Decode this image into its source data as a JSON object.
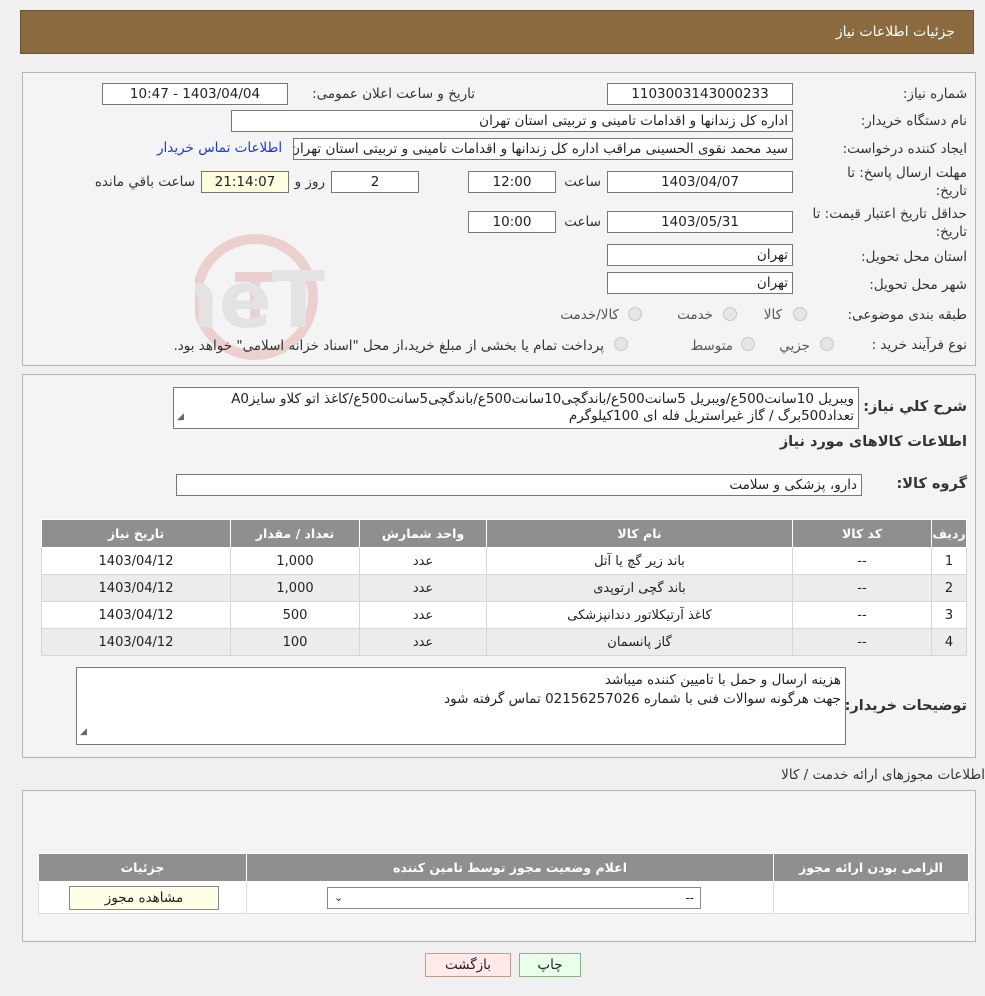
{
  "header": {
    "title": "جزئیات اطلاعات نیاز"
  },
  "fields": {
    "need_number_label": "شماره نیاز:",
    "need_number": "1103003143000233",
    "announce_label": "تاریخ و ساعت اعلان عمومی:",
    "announce_value": "1403/04/04 - 10:47",
    "buyer_label": "نام دستگاه خریدار:",
    "buyer_value": "اداره کل زندانها و اقدامات تامینی و تربیتی استان تهران",
    "creator_label": "ایجاد کننده درخواست:",
    "creator_value": "سید محمد نقوی الحسینی مراقب  اداره کل زندانها و اقدامات تامینی و تربیتی استان تهران",
    "contact_link": "اطلاعات تماس خریدار",
    "deadline_label": "مهلت ارسال پاسخ: تا تاریخ:",
    "deadline_date": "1403/04/07",
    "hour_label": "ساعت",
    "deadline_time": "12:00",
    "days_value": "2",
    "days_label": "روز و",
    "remaining_value": "21:14:07",
    "remaining_label": "ساعت باقي مانده",
    "validity_label": "حداقل تاریخ اعتبار قیمت: تا تاریخ:",
    "validity_date": "1403/05/31",
    "validity_hour_label": "ساعت",
    "validity_time": "10:00",
    "province_label": "استان محل تحویل:",
    "province_value": "تهران",
    "city_label": "شهر محل تحویل:",
    "city_value": "تهران",
    "category_label": "طبقه بندی موضوعی:",
    "category_options": [
      "کالا",
      "خدمت",
      "کالا/خدمت"
    ],
    "process_label": "نوع فرآیند خرید :",
    "process_options": [
      "جزيي",
      "متوسط"
    ],
    "process_note": "پرداخت تمام یا بخشی از مبلغ خرید،از محل \"اسناد خزانه اسلامی\" خواهد بود."
  },
  "summary": {
    "label": "شرح کلي نياز:",
    "text": "ویبریل 10سانت500ع/ویبریل 5سانت500ع/باندگچی10سانت500ع/باندگچی5سانت500ع/کاغذ اتو کلاو سایزA0 تعداد500برگ / گاز غیراستریل فله ای 100کیلوگرم",
    "goods_info_label": "اطلاعات کالاهای مورد نیاز",
    "group_label": "گروه کالا:",
    "group_value": "دارو، پزشکی و سلامت"
  },
  "items_table": {
    "headers": [
      "ردیف",
      "کد کالا",
      "نام کالا",
      "واحد شمارش",
      "تعداد / مقدار",
      "تاریخ نیاز"
    ],
    "rows": [
      [
        "1",
        "--",
        "باند زیر گچ یا آتل",
        "عدد",
        "1,000",
        "1403/04/12"
      ],
      [
        "2",
        "--",
        "باند گچی ارتوپدی",
        "عدد",
        "1,000",
        "1403/04/12"
      ],
      [
        "3",
        "--",
        "کاغذ آرتیکلاتور دندانپزشکی",
        "عدد",
        "500",
        "1403/04/12"
      ],
      [
        "4",
        "--",
        "گاز پانسمان",
        "عدد",
        "100",
        "1403/04/12"
      ]
    ]
  },
  "buyer_notes": {
    "label": "توضیحات خریدار:",
    "line1": "هزینه ارسال و حمل با تامیین کننده میباشد",
    "line2": "جهت هرگونه سوالات فنی با شماره 02156257026 تماس گرفته شود"
  },
  "licenses": {
    "section_title": "اطلاعات مجوزهای ارائه خدمت / کالا",
    "headers": [
      "الزامی بودن ارائه مجوز",
      "اعلام وضعیت مجوز توسط تامین کننده",
      "جزئیات"
    ],
    "select_value": "--",
    "view_button": "مشاهده مجوز"
  },
  "footer": {
    "print": "چاپ",
    "back": "بازگشت"
  },
  "watermark": {
    "text": "AriaTender.neT"
  }
}
